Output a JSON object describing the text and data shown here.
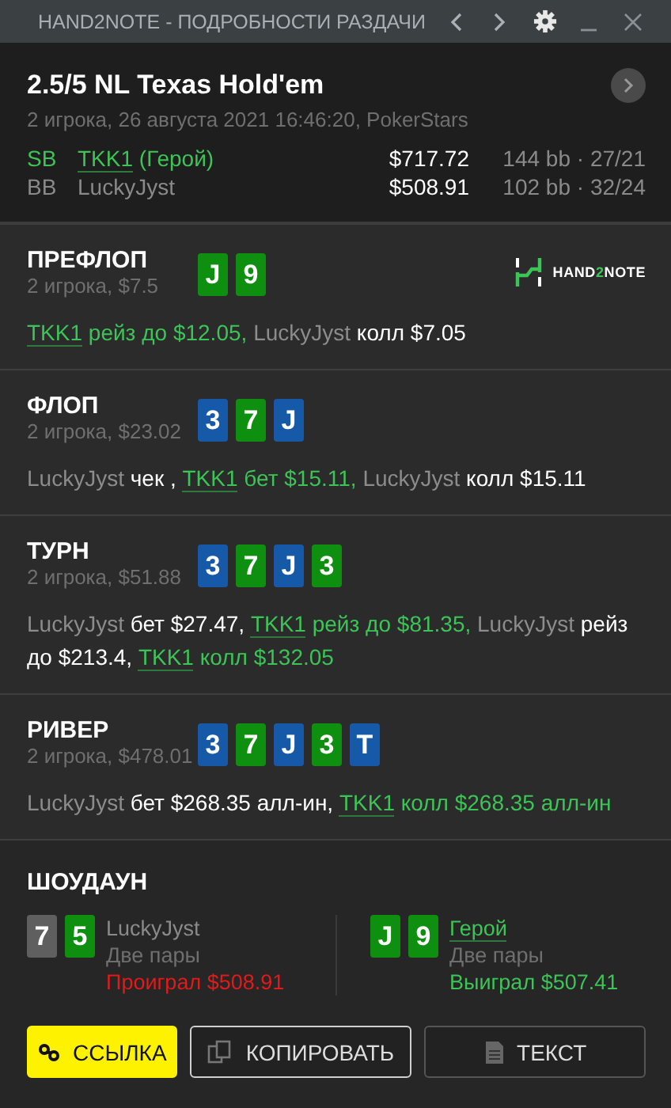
{
  "window": {
    "title": "HAND2NOTE - ПОДРОБНОСТИ РАЗДАЧИ"
  },
  "header": {
    "title": "2.5/5 NL Texas Hold'em",
    "subtitle": "2 игрока, 26 августа 2021 16:46:20, PokerStars",
    "players": [
      {
        "position": "SB",
        "name": "TKK1",
        "hero": true,
        "note": "(Герой)",
        "stack": "$717.72",
        "bb": "144 bb",
        "separator": "·",
        "stats": "27/21"
      },
      {
        "position": "BB",
        "name": "LuckyJyst",
        "hero": false,
        "stack": "$508.91",
        "bb": "102 bb",
        "separator": "·",
        "stats": "32/24"
      }
    ]
  },
  "streets": [
    {
      "title": "ПРЕФЛОП",
      "subtitle": "2 игрока, $7.5",
      "logo": {
        "before": "HAND",
        "accent": "2",
        "after": "NOTE"
      },
      "cards": [
        {
          "rank": "J",
          "color": "#0f8f0f"
        },
        {
          "rank": "9",
          "color": "#0f8f0f"
        }
      ],
      "actions": [
        {
          "kind": "hero",
          "text": "TKK1"
        },
        {
          "kind": "hero_text",
          "text": " рейз до $12.05, "
        },
        {
          "kind": "name",
          "text": "LuckyJyst"
        },
        {
          "kind": "text",
          "text": " колл $7.05"
        }
      ]
    },
    {
      "title": "ФЛОП",
      "subtitle": "2 игрока, $23.02",
      "cards": [
        {
          "rank": "3",
          "color": "#1659a8"
        },
        {
          "rank": "7",
          "color": "#0f8f0f"
        },
        {
          "rank": "J",
          "color": "#1659a8"
        }
      ],
      "actions": [
        {
          "kind": "name",
          "text": "LuckyJyst"
        },
        {
          "kind": "text",
          "text": " чек , "
        },
        {
          "kind": "hero",
          "text": "TKK1"
        },
        {
          "kind": "hero_text",
          "text": " бет $15.11, "
        },
        {
          "kind": "name",
          "text": "LuckyJyst"
        },
        {
          "kind": "text",
          "text": " колл $15.11"
        }
      ]
    },
    {
      "title": "ТУРН",
      "subtitle": "2 игрока, $51.88",
      "cards": [
        {
          "rank": "3",
          "color": "#1659a8"
        },
        {
          "rank": "7",
          "color": "#0f8f0f"
        },
        {
          "rank": "J",
          "color": "#1659a8"
        },
        {
          "rank": "3",
          "color": "#0f8f0f"
        }
      ],
      "actions": [
        {
          "kind": "name",
          "text": "LuckyJyst"
        },
        {
          "kind": "text",
          "text": " бет $27.47, "
        },
        {
          "kind": "hero",
          "text": "TKK1"
        },
        {
          "kind": "hero_text",
          "text": " рейз до $81.35, "
        },
        {
          "kind": "name",
          "text": "LuckyJyst"
        },
        {
          "kind": "text",
          "text": " рейз до $213.4, "
        },
        {
          "kind": "hero",
          "text": "TKK1"
        },
        {
          "kind": "hero_text",
          "text": " колл $132.05"
        }
      ]
    },
    {
      "title": "РИВЕР",
      "subtitle": "2 игрока, $478.01",
      "cards": [
        {
          "rank": "3",
          "color": "#1659a8"
        },
        {
          "rank": "7",
          "color": "#0f8f0f"
        },
        {
          "rank": "J",
          "color": "#1659a8"
        },
        {
          "rank": "3",
          "color": "#0f8f0f"
        },
        {
          "rank": "T",
          "color": "#1659a8"
        }
      ],
      "actions": [
        {
          "kind": "name",
          "text": "LuckyJyst"
        },
        {
          "kind": "text",
          "text": " бет $268.35 алл-ин, "
        },
        {
          "kind": "hero",
          "text": "TKK1"
        },
        {
          "kind": "hero_text",
          "text": " колл $268.35 алл-ин"
        }
      ]
    }
  ],
  "showdown": {
    "title": "ШОУДАУН",
    "players": [
      {
        "name": "LuckyJyst",
        "hero": false,
        "hand": "Две пары",
        "result": "Проиграл $508.91",
        "color": "#e21a1a",
        "cards": [
          {
            "rank": "7",
            "color": "#5f5f5f"
          },
          {
            "rank": "5",
            "color": "#0f8f0f"
          }
        ]
      },
      {
        "name": "Герой",
        "hero": true,
        "hand": "Две пары",
        "result": "Выиграл $507.41",
        "color": "#3cc457",
        "cards": [
          {
            "rank": "J",
            "color": "#0f8f0f"
          },
          {
            "rank": "9",
            "color": "#0f8f0f"
          }
        ]
      }
    ]
  },
  "buttons": [
    {
      "kind": "link",
      "label": "ССЫЛКА"
    },
    {
      "kind": "copy",
      "label": "КОПИРОВАТЬ"
    },
    {
      "kind": "text",
      "label": "ТЕКСТ"
    }
  ]
}
